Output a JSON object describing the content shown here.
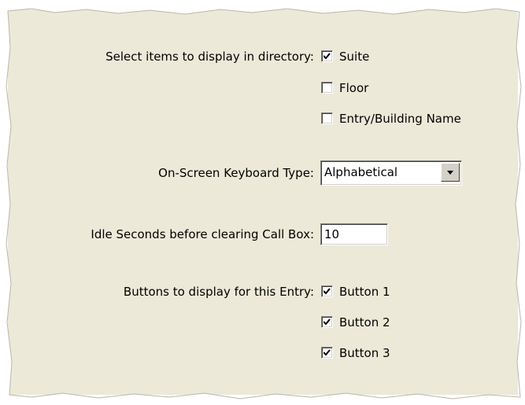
{
  "directory": {
    "label": "Select items to display in directory:",
    "options": [
      {
        "label": "Suite",
        "checked": true
      },
      {
        "label": "Floor",
        "checked": false
      },
      {
        "label": "Entry/Building Name",
        "checked": false
      }
    ]
  },
  "keyboard": {
    "label": "On-Screen Keyboard Type:",
    "selected": "Alphabetical"
  },
  "idle": {
    "label": "Idle Seconds before clearing Call Box:",
    "value": "10"
  },
  "buttons": {
    "label": "Buttons to display for this Entry:",
    "options": [
      {
        "label": "Button 1",
        "checked": true
      },
      {
        "label": "Button 2",
        "checked": true
      },
      {
        "label": "Button 3",
        "checked": true
      }
    ]
  },
  "colors": {
    "panel_bg": "#ece9d8",
    "page_bg": "#ffffff"
  }
}
